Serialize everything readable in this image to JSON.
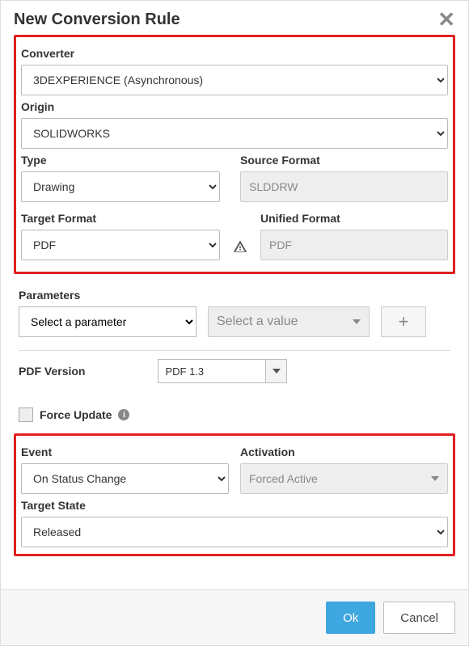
{
  "title": "New Conversion Rule",
  "labels": {
    "converter": "Converter",
    "origin": "Origin",
    "type": "Type",
    "source_format": "Source Format",
    "target_format": "Target Format",
    "unified_format": "Unified Format",
    "parameters": "Parameters",
    "pdf_version": "PDF Version",
    "force_update": "Force Update",
    "event": "Event",
    "activation": "Activation",
    "target_state": "Target State"
  },
  "values": {
    "converter": "3DEXPERIENCE (Asynchronous)",
    "origin": "SOLIDWORKS",
    "type": "Drawing",
    "source_format": "SLDDRW",
    "target_format": "PDF",
    "unified_format": "PDF",
    "param_placeholder": "Select a parameter",
    "value_placeholder": "Select a value",
    "pdf_version": "PDF 1.3",
    "event": "On Status Change",
    "activation": "Forced Active",
    "target_state": "Released"
  },
  "buttons": {
    "ok": "Ok",
    "cancel": "Cancel",
    "plus": "+"
  }
}
